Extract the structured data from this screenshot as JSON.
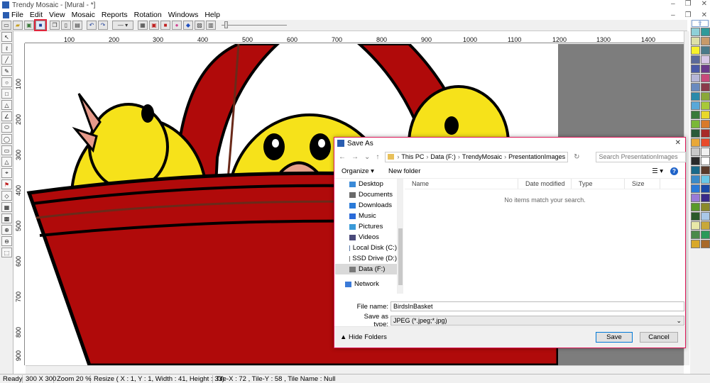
{
  "window": {
    "title": "Trendy Mosaic - [Mural - *]",
    "minimize": "‒",
    "restore": "❐",
    "close": "✕"
  },
  "menu": [
    "File",
    "Edit",
    "View",
    "Mosaic",
    "Reports",
    "Rotation",
    "Windows",
    "Help"
  ],
  "toolbar": {
    "buttons": [
      "new-file",
      "open-file",
      "save-file",
      "save-as",
      "copy",
      "paste",
      "undo",
      "redo",
      "line-style",
      "grid",
      "tile",
      "color",
      "palette",
      "image",
      "chart"
    ],
    "highlighted": "save-file"
  },
  "tools": [
    "arrow",
    "pencil",
    "line",
    "pen",
    "rect",
    "ellipse",
    "rect-fill",
    "triangle",
    "poly",
    "ellipse-fill",
    "rect-outline",
    "triangle-fill",
    "dropper",
    "fill",
    "eraser",
    "grid",
    "zoom-in",
    "zoom-out",
    "select",
    "lasso"
  ],
  "ruler_top": [
    "100",
    "200",
    "300",
    "400",
    "500",
    "600",
    "700",
    "800",
    "900",
    "1000",
    "1100",
    "1200",
    "1300",
    "1400"
  ],
  "ruler_left": [
    "100",
    "200",
    "300",
    "400",
    "500",
    "600",
    "700",
    "800",
    "900"
  ],
  "palette_colors": [
    "#8fd0d8",
    "#2e9a9a",
    "#dde0a8",
    "#c89a6a",
    "#f7f12a",
    "#4a7a8a",
    "#5b6a9a",
    "#d8c8e8",
    "#4a5aa8",
    "#6a3a8a",
    "#b6b6d8",
    "#c84a7a",
    "#6a8abf",
    "#8a3a4a",
    "#2a8aaa",
    "#8aa838",
    "#5aa8d8",
    "#a8c838",
    "#3a7a3a",
    "#e8d82a",
    "#7ab838",
    "#d87a2a",
    "#2a5a3a",
    "#a82a2a",
    "#e8a838",
    "#e84a2a",
    "#c8c8c8",
    "#f0f0f0",
    "#2a2a2a",
    "#ffffff",
    "#1a6a8a",
    "#5a3a2a",
    "#3a8ac8",
    "#6ac8e8",
    "#2a7ad8",
    "#1a4aa8",
    "#9a7ad8",
    "#3a2a8a",
    "#5a9a2a",
    "#8a8a2a",
    "#2a5a2a",
    "#aac8e8",
    "#e8e8a8",
    "#c8a838",
    "#4a8a4a",
    "#2a9a5a",
    "#d8a82a",
    "#a86a2a"
  ],
  "statusbar": {
    "ready": "Ready",
    "size": "300 X 300",
    "zoom": "Zoom 20 %",
    "resize": "Resize ( X : 1, Y : 1, Width : 41, Height : 33)",
    "tile_info": "Tile-X : 72 , Tile-Y : 58 , Tile Name : Null"
  },
  "dialog": {
    "title": "Save As",
    "close": "✕",
    "path": [
      "This PC",
      "Data (F:)",
      "TrendyMosaic",
      "PresentationImages"
    ],
    "search_placeholder": "Search PresentationImages",
    "organize": "Organize ▾",
    "new_folder": "New folder",
    "help": "?",
    "nav_items": [
      {
        "label": "Desktop",
        "color": "#3a8ad8",
        "selected": false
      },
      {
        "label": "Documents",
        "color": "#6a6a6a",
        "selected": false
      },
      {
        "label": "Downloads",
        "color": "#2a7ad8",
        "selected": false
      },
      {
        "label": "Music",
        "color": "#2a6ad8",
        "selected": false
      },
      {
        "label": "Pictures",
        "color": "#3a9ad8",
        "selected": false
      },
      {
        "label": "Videos",
        "color": "#4a4a7a",
        "selected": false
      },
      {
        "label": "Local Disk (C:)",
        "color": "#5a7aa8",
        "selected": false
      },
      {
        "label": "SSD Drive (D:)",
        "color": "#7a7a7a",
        "selected": false
      },
      {
        "label": "Data (F:)",
        "color": "#7a7a7a",
        "selected": true
      },
      {
        "label": "Network",
        "color": "#3a7ad8",
        "selected": false
      }
    ],
    "columns": [
      "Name",
      "Date modified",
      "Type",
      "Size"
    ],
    "empty_message": "No items match your search.",
    "file_name_label": "File name:",
    "file_name_value": "BirdsInBasket",
    "save_type_label": "Save as type:",
    "save_type_value": "JPEG (*.jpeg;*.jpg)",
    "hide_folders": "Hide Folders",
    "save_button": "Save",
    "cancel_button": "Cancel"
  }
}
